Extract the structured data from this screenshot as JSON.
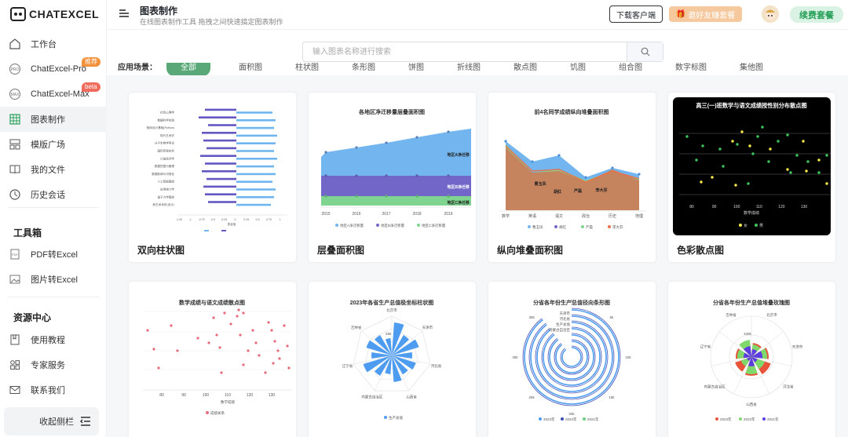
{
  "logo": {
    "text": "ChatExcel"
  },
  "sidebar": {
    "items": [
      {
        "label": "工作台",
        "icon": "home-icon"
      },
      {
        "label": "ChatExcel-Pro",
        "icon": "pro-icon",
        "tag": "推荐"
      },
      {
        "label": "ChatExcel-Max",
        "icon": "max-icon",
        "tag": "beta"
      },
      {
        "label": "图表制作",
        "icon": "table-chart-icon",
        "active": true
      },
      {
        "label": "模版广场",
        "icon": "template-icon"
      },
      {
        "label": "我的文件",
        "icon": "book-icon"
      },
      {
        "label": "历史会话",
        "icon": "clock-icon"
      }
    ],
    "toolbox_title": "工具箱",
    "tools": [
      {
        "label": "PDF转Excel",
        "icon": "pdf-icon"
      },
      {
        "label": "图片转Excel",
        "icon": "image-icon"
      }
    ],
    "resources_title": "资源中心",
    "resources": [
      {
        "label": "使用教程",
        "icon": "tutorial-icon"
      },
      {
        "label": "专家服务",
        "icon": "grid-icon"
      },
      {
        "label": "联系我们",
        "icon": "mail-icon"
      }
    ],
    "collapse_label": "收起侧栏"
  },
  "header": {
    "title": "图表制作",
    "subtitle": "在线图表制作工具 拖拽之间快速搞定图表制作",
    "download_label": "下载客户端",
    "invite_label": "邀好友赚套餐",
    "renew_label": "续费套餐"
  },
  "search": {
    "placeholder": "输入图表名称进行搜索"
  },
  "categories": {
    "label": "应用场景：",
    "items": [
      "全部",
      "面积图",
      "柱状图",
      "条形图",
      "饼图",
      "折线图",
      "散点图",
      "饥图",
      "组合图",
      "数字标图",
      "集他图"
    ]
  },
  "cards": [
    {
      "title": "双向柱状图"
    },
    {
      "title": "层叠面积图"
    },
    {
      "title": "纵向堆叠面积图"
    },
    {
      "title": "色彩散点图"
    },
    {
      "title": "",
      "inner_title": "数学成绩与语文成绩散点图"
    },
    {
      "title": "",
      "inner_title": "2023年各省生产总值极坐标柱状图"
    },
    {
      "title": "",
      "inner_title": "分省各年份生产总值径向条形图"
    },
    {
      "title": "",
      "inner_title": "分省各年份生产总值堆叠玫瑰图"
    }
  ],
  "thumbs": {
    "c1": {
      "categories": [
        "社会心理学",
        "数据科学实践",
        "程序设计基础(Python)",
        "现代艺术史",
        "分子生物学导论",
        "国际贸易实务",
        "计量经济学",
        "数据挖掘与管理",
        "数据新闻与可视化",
        "人工智能基础",
        "应用统计学",
        "量子力学基础",
        "新艺术术史(设计)"
      ],
      "ticks": [
        "-1.25",
        "-1",
        "-0.75",
        "-0.5",
        "-0.25",
        "0",
        "0.25",
        "0.5",
        "0.75",
        "1"
      ],
      "xlabel": "数量值"
    },
    "c2": {
      "title": "各地区净迁移量层叠面积图",
      "years": [
        "2015",
        "2016",
        "2017",
        "2018",
        "2019"
      ],
      "labels": [
        "地区A净迁移",
        "地区B净迁移",
        "地区C净迁移"
      ],
      "legend": [
        "地区A净迁移量",
        "地区B净迁移量",
        "地区C净迁移量"
      ],
      "colors": [
        "#73b5ee",
        "#7267c9",
        "#7fd58f"
      ]
    },
    "c3": {
      "title": "前4名同学成绩纵向堆叠面积图",
      "subjects": [
        "数学",
        "英语",
        "语文",
        "政治",
        "历史",
        "地理"
      ],
      "names": [
        "曹玉凤",
        "胡红",
        "严磊",
        "李大芬"
      ],
      "colors": [
        "#73b5ee",
        "#7267c9",
        "#7fd58f",
        "#e8724a"
      ]
    },
    "c4": {
      "title": "高三(一)班数学与语文成绩按性别分布散点图",
      "xticks": [
        "80",
        "90",
        "100",
        "110",
        "120",
        "130"
      ],
      "xlabel": "数学成绩",
      "legend": [
        "女",
        "男"
      ]
    },
    "c5": {
      "title": "数学成绩与语文成绩散点图",
      "xticks": [
        "80",
        "90",
        "100",
        "110",
        "120",
        "130",
        "1"
      ],
      "xlabel": "数学成绩",
      "legend": "成绩关系"
    },
    "c6": {
      "title": "2023年各省生产总值极坐标柱状图",
      "provinces": [
        "北京市",
        "天津市",
        "河北省",
        "山西省",
        "内蒙古自治区",
        "辽宁省",
        "吉林省"
      ],
      "ring_label": "25k",
      "legend": "生产总值"
    },
    "c7": {
      "title": "分省各年份生产总值径向条形图",
      "ticks": [
        "0",
        "5k",
        "10k",
        "15k",
        "20k",
        "25k",
        "30k",
        "35k"
      ],
      "provinces": [
        "天津市",
        "河北省",
        "生产总值",
        "内蒙古自治区"
      ],
      "legend": [
        "2023年",
        "2022年",
        "2021年"
      ]
    },
    "c8": {
      "title": "分省各年份生产总值堆叠玫瑰图",
      "provinces": [
        "北京市",
        "天津市",
        "河北省",
        "山西省",
        "内蒙古自治区",
        "辽宁省",
        "吉林省"
      ],
      "ring_label": "100k",
      "legend": [
        "2023年",
        "2022年",
        "2021年"
      ]
    }
  }
}
